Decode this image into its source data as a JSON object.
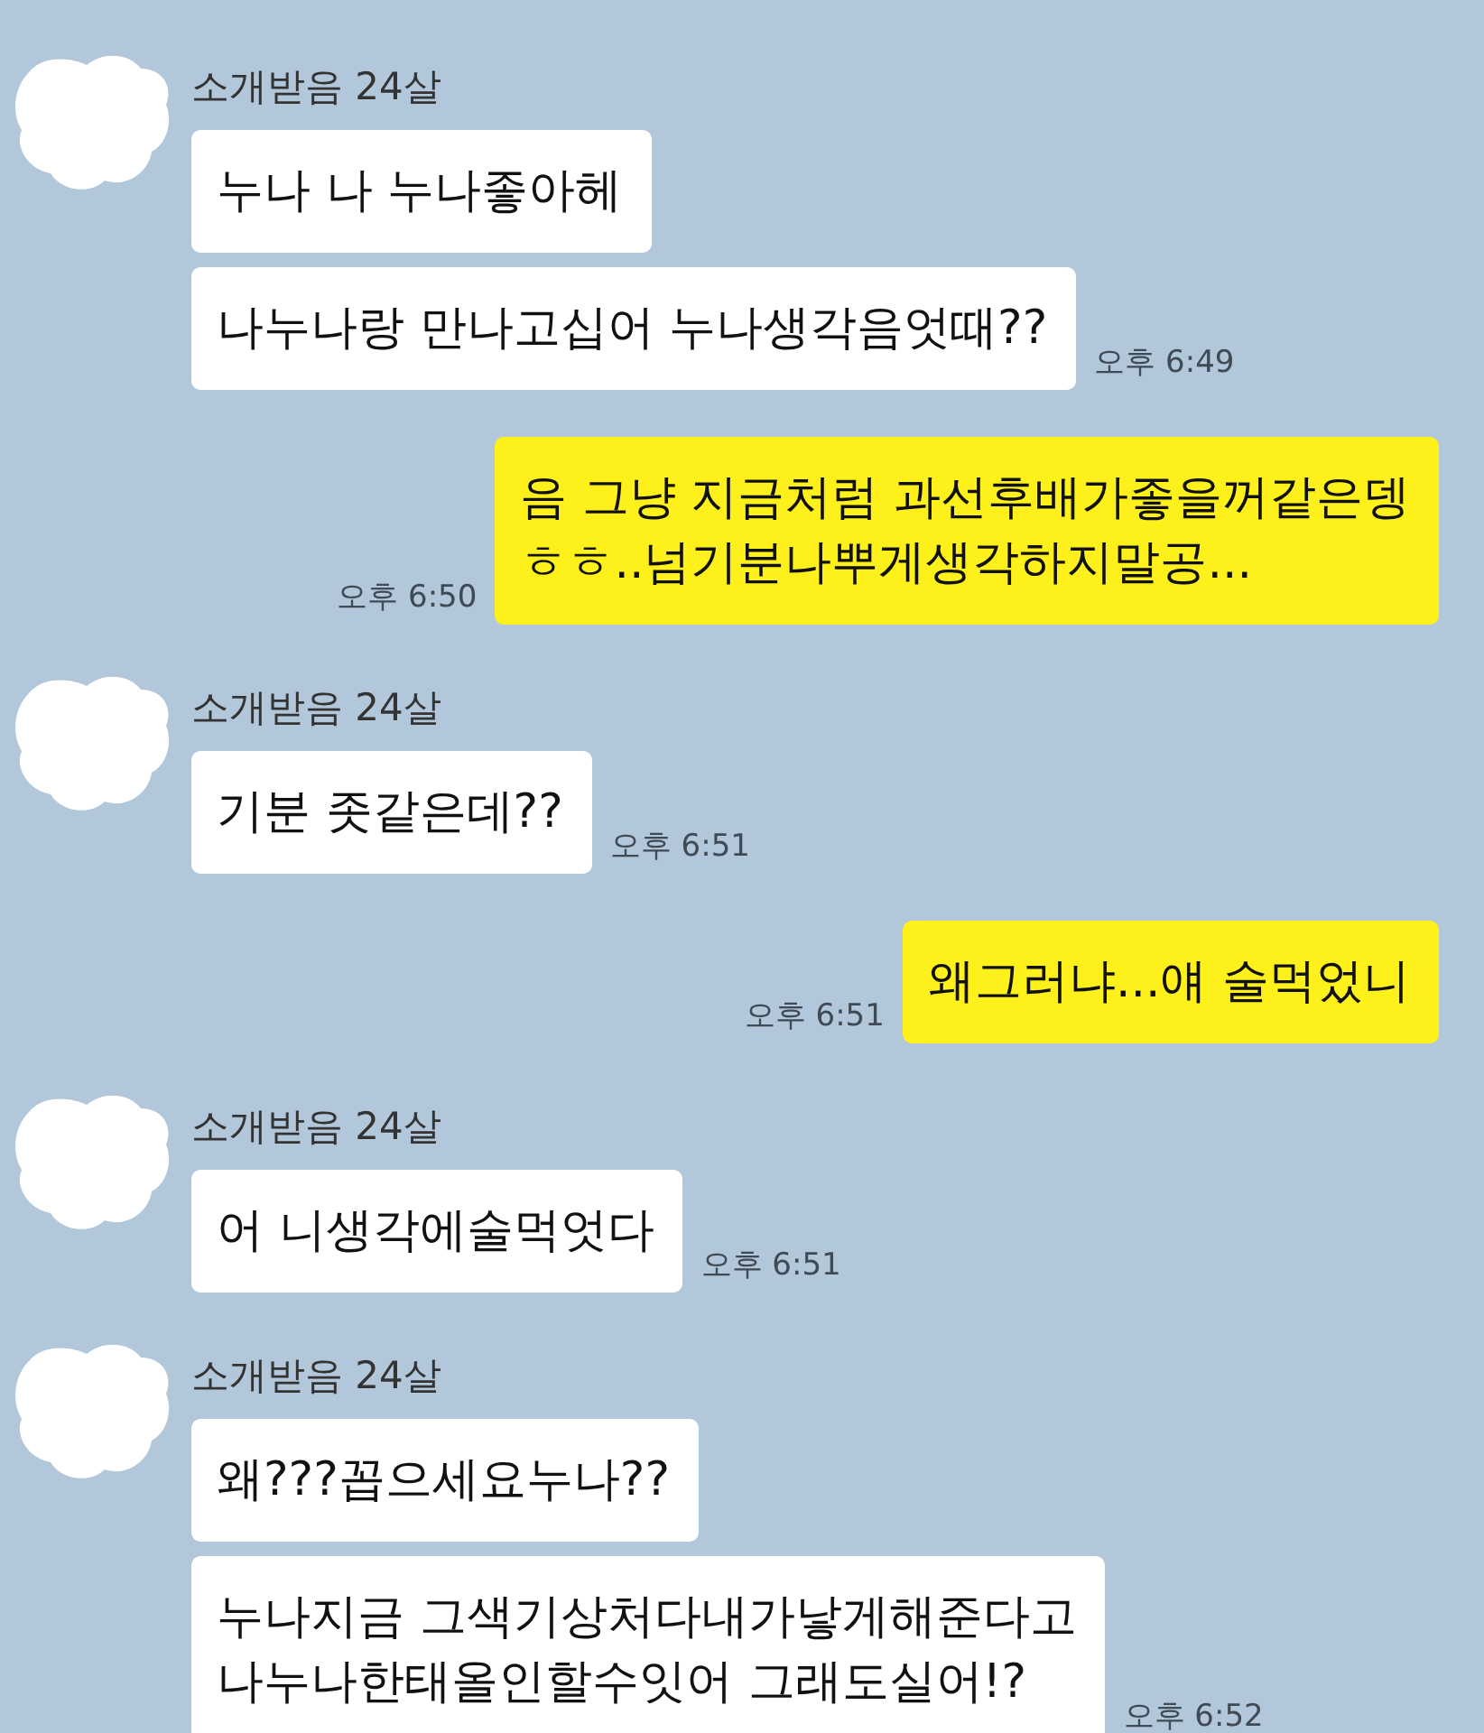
{
  "groups": [
    {
      "kind": "received",
      "sender": "소개받음 24살",
      "messages": [
        {
          "text": "누나 나 누나좋아헤"
        },
        {
          "text": "나누나랑 만나고십어 누나생각음엇때??",
          "time": "오후 6:49"
        }
      ]
    },
    {
      "kind": "sent",
      "messages": [
        {
          "text": "음 그냥 지금처럼 과선후배가좋을꺼같은뎅\nㅎㅎ..넘기분나뿌게생각하지말공...",
          "time": "오후 6:50"
        }
      ]
    },
    {
      "kind": "received",
      "sender": "소개받음 24살",
      "messages": [
        {
          "text": "기분 좃같은데??",
          "time": "오후 6:51"
        }
      ]
    },
    {
      "kind": "sent",
      "messages": [
        {
          "text": "왜그러냐...얘 술먹었니",
          "time": "오후 6:51"
        }
      ]
    },
    {
      "kind": "received",
      "sender": "소개받음 24살",
      "messages": [
        {
          "text": "어 니생각에술먹엇다",
          "time": "오후 6:51"
        }
      ]
    },
    {
      "kind": "received",
      "sender": "소개받음 24살",
      "messages": [
        {
          "text": "왜???꼽으세요누나??"
        },
        {
          "text": "누나지금 그색기상처다내가낳게해준다고\n나누나한태올인할수잇어 그래도실어!?",
          "time": "오후 6:52"
        }
      ]
    }
  ]
}
